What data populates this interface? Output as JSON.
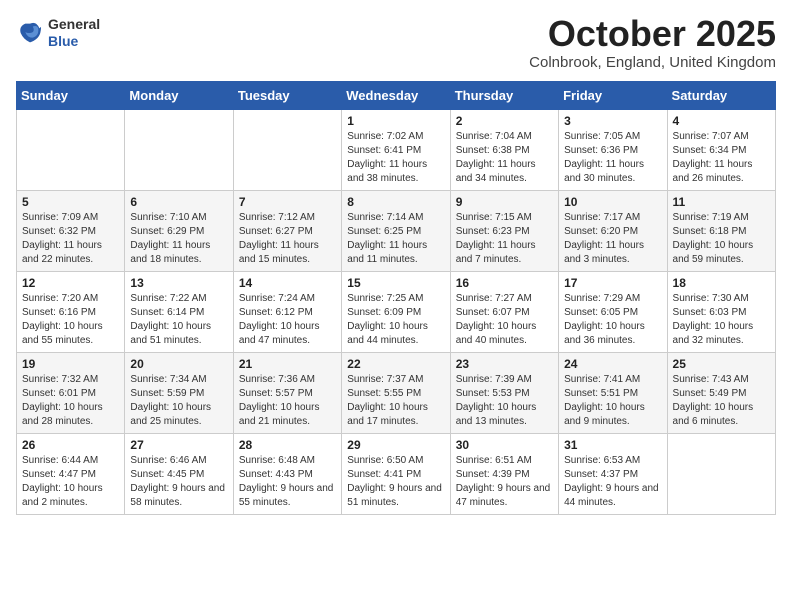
{
  "header": {
    "logo": {
      "general": "General",
      "blue": "Blue"
    },
    "title": "October 2025",
    "location": "Colnbrook, England, United Kingdom"
  },
  "days_of_week": [
    "Sunday",
    "Monday",
    "Tuesday",
    "Wednesday",
    "Thursday",
    "Friday",
    "Saturday"
  ],
  "weeks": [
    [
      {
        "day": "",
        "sunrise": "",
        "sunset": "",
        "daylight": ""
      },
      {
        "day": "",
        "sunrise": "",
        "sunset": "",
        "daylight": ""
      },
      {
        "day": "",
        "sunrise": "",
        "sunset": "",
        "daylight": ""
      },
      {
        "day": "1",
        "sunrise": "Sunrise: 7:02 AM",
        "sunset": "Sunset: 6:41 PM",
        "daylight": "Daylight: 11 hours and 38 minutes."
      },
      {
        "day": "2",
        "sunrise": "Sunrise: 7:04 AM",
        "sunset": "Sunset: 6:38 PM",
        "daylight": "Daylight: 11 hours and 34 minutes."
      },
      {
        "day": "3",
        "sunrise": "Sunrise: 7:05 AM",
        "sunset": "Sunset: 6:36 PM",
        "daylight": "Daylight: 11 hours and 30 minutes."
      },
      {
        "day": "4",
        "sunrise": "Sunrise: 7:07 AM",
        "sunset": "Sunset: 6:34 PM",
        "daylight": "Daylight: 11 hours and 26 minutes."
      }
    ],
    [
      {
        "day": "5",
        "sunrise": "Sunrise: 7:09 AM",
        "sunset": "Sunset: 6:32 PM",
        "daylight": "Daylight: 11 hours and 22 minutes."
      },
      {
        "day": "6",
        "sunrise": "Sunrise: 7:10 AM",
        "sunset": "Sunset: 6:29 PM",
        "daylight": "Daylight: 11 hours and 18 minutes."
      },
      {
        "day": "7",
        "sunrise": "Sunrise: 7:12 AM",
        "sunset": "Sunset: 6:27 PM",
        "daylight": "Daylight: 11 hours and 15 minutes."
      },
      {
        "day": "8",
        "sunrise": "Sunrise: 7:14 AM",
        "sunset": "Sunset: 6:25 PM",
        "daylight": "Daylight: 11 hours and 11 minutes."
      },
      {
        "day": "9",
        "sunrise": "Sunrise: 7:15 AM",
        "sunset": "Sunset: 6:23 PM",
        "daylight": "Daylight: 11 hours and 7 minutes."
      },
      {
        "day": "10",
        "sunrise": "Sunrise: 7:17 AM",
        "sunset": "Sunset: 6:20 PM",
        "daylight": "Daylight: 11 hours and 3 minutes."
      },
      {
        "day": "11",
        "sunrise": "Sunrise: 7:19 AM",
        "sunset": "Sunset: 6:18 PM",
        "daylight": "Daylight: 10 hours and 59 minutes."
      }
    ],
    [
      {
        "day": "12",
        "sunrise": "Sunrise: 7:20 AM",
        "sunset": "Sunset: 6:16 PM",
        "daylight": "Daylight: 10 hours and 55 minutes."
      },
      {
        "day": "13",
        "sunrise": "Sunrise: 7:22 AM",
        "sunset": "Sunset: 6:14 PM",
        "daylight": "Daylight: 10 hours and 51 minutes."
      },
      {
        "day": "14",
        "sunrise": "Sunrise: 7:24 AM",
        "sunset": "Sunset: 6:12 PM",
        "daylight": "Daylight: 10 hours and 47 minutes."
      },
      {
        "day": "15",
        "sunrise": "Sunrise: 7:25 AM",
        "sunset": "Sunset: 6:09 PM",
        "daylight": "Daylight: 10 hours and 44 minutes."
      },
      {
        "day": "16",
        "sunrise": "Sunrise: 7:27 AM",
        "sunset": "Sunset: 6:07 PM",
        "daylight": "Daylight: 10 hours and 40 minutes."
      },
      {
        "day": "17",
        "sunrise": "Sunrise: 7:29 AM",
        "sunset": "Sunset: 6:05 PM",
        "daylight": "Daylight: 10 hours and 36 minutes."
      },
      {
        "day": "18",
        "sunrise": "Sunrise: 7:30 AM",
        "sunset": "Sunset: 6:03 PM",
        "daylight": "Daylight: 10 hours and 32 minutes."
      }
    ],
    [
      {
        "day": "19",
        "sunrise": "Sunrise: 7:32 AM",
        "sunset": "Sunset: 6:01 PM",
        "daylight": "Daylight: 10 hours and 28 minutes."
      },
      {
        "day": "20",
        "sunrise": "Sunrise: 7:34 AM",
        "sunset": "Sunset: 5:59 PM",
        "daylight": "Daylight: 10 hours and 25 minutes."
      },
      {
        "day": "21",
        "sunrise": "Sunrise: 7:36 AM",
        "sunset": "Sunset: 5:57 PM",
        "daylight": "Daylight: 10 hours and 21 minutes."
      },
      {
        "day": "22",
        "sunrise": "Sunrise: 7:37 AM",
        "sunset": "Sunset: 5:55 PM",
        "daylight": "Daylight: 10 hours and 17 minutes."
      },
      {
        "day": "23",
        "sunrise": "Sunrise: 7:39 AM",
        "sunset": "Sunset: 5:53 PM",
        "daylight": "Daylight: 10 hours and 13 minutes."
      },
      {
        "day": "24",
        "sunrise": "Sunrise: 7:41 AM",
        "sunset": "Sunset: 5:51 PM",
        "daylight": "Daylight: 10 hours and 9 minutes."
      },
      {
        "day": "25",
        "sunrise": "Sunrise: 7:43 AM",
        "sunset": "Sunset: 5:49 PM",
        "daylight": "Daylight: 10 hours and 6 minutes."
      }
    ],
    [
      {
        "day": "26",
        "sunrise": "Sunrise: 6:44 AM",
        "sunset": "Sunset: 4:47 PM",
        "daylight": "Daylight: 10 hours and 2 minutes."
      },
      {
        "day": "27",
        "sunrise": "Sunrise: 6:46 AM",
        "sunset": "Sunset: 4:45 PM",
        "daylight": "Daylight: 9 hours and 58 minutes."
      },
      {
        "day": "28",
        "sunrise": "Sunrise: 6:48 AM",
        "sunset": "Sunset: 4:43 PM",
        "daylight": "Daylight: 9 hours and 55 minutes."
      },
      {
        "day": "29",
        "sunrise": "Sunrise: 6:50 AM",
        "sunset": "Sunset: 4:41 PM",
        "daylight": "Daylight: 9 hours and 51 minutes."
      },
      {
        "day": "30",
        "sunrise": "Sunrise: 6:51 AM",
        "sunset": "Sunset: 4:39 PM",
        "daylight": "Daylight: 9 hours and 47 minutes."
      },
      {
        "day": "31",
        "sunrise": "Sunrise: 6:53 AM",
        "sunset": "Sunset: 4:37 PM",
        "daylight": "Daylight: 9 hours and 44 minutes."
      },
      {
        "day": "",
        "sunrise": "",
        "sunset": "",
        "daylight": ""
      }
    ]
  ]
}
